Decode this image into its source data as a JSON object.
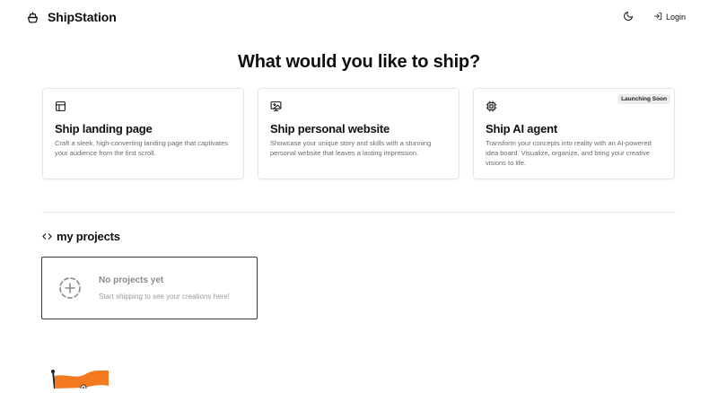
{
  "header": {
    "brand": "ShipStation",
    "login_label": "Login",
    "icons": {
      "brand": "ship-icon",
      "theme": "moon-icon",
      "login": "login-icon"
    }
  },
  "hero": {
    "title": "What would you like to ship?"
  },
  "cards": [
    {
      "icon": "layout-icon",
      "title": "Ship landing page",
      "description": "Craft a sleek, high-converting landing page that captivates your audience from the first scroll."
    },
    {
      "icon": "monitor-image-icon",
      "title": "Ship personal website",
      "description": "Showcase your unique story and skills with a stunning personal website that leaves a lasting impression."
    },
    {
      "icon": "cpu-icon",
      "title": "Ship AI agent",
      "description": "Transform your concepts into reality with an AI-powered idea board. Visualize, organize, and bring your creative visions to life.",
      "badge": "Launching Soon"
    }
  ],
  "projects": {
    "heading": "my projects",
    "empty_title": "No projects yet",
    "empty_subtitle": "Start shipping to see your creations here!"
  },
  "colors": {
    "text": "#0f0f0f",
    "muted": "#6b6b6b",
    "border": "#e6e6e6",
    "badge_bg": "#ececec",
    "flag": "#f47a20"
  }
}
